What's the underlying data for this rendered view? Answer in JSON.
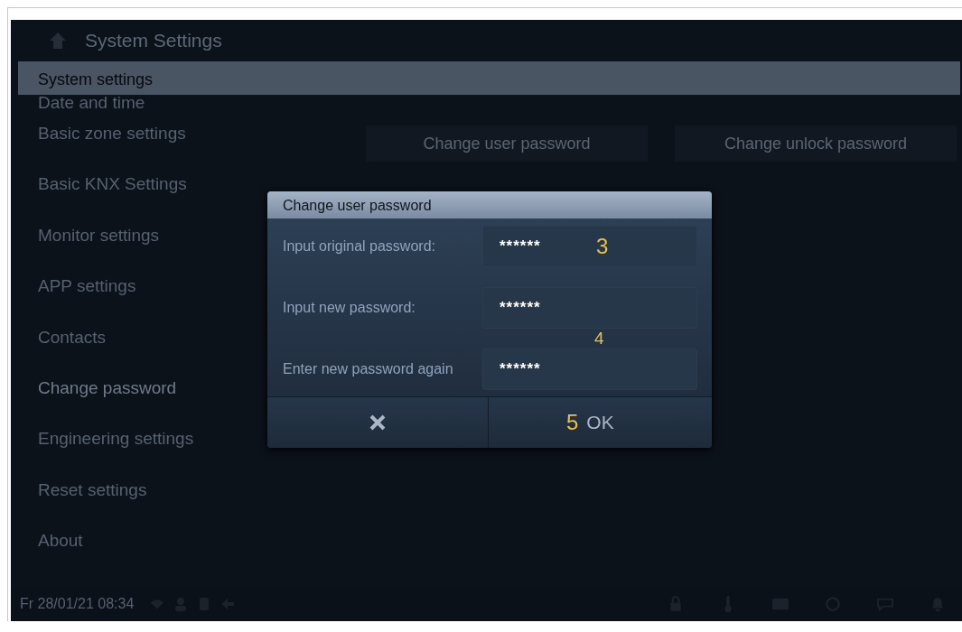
{
  "top_bar": {
    "title": "System Settings"
  },
  "section_header": "System settings",
  "sidebar": {
    "items": [
      {
        "label": "Date and time",
        "selected": false
      },
      {
        "label": "Basic zone settings",
        "selected": false
      },
      {
        "label": "Basic KNX Settings",
        "selected": false
      },
      {
        "label": "Monitor settings",
        "selected": false
      },
      {
        "label": "APP settings",
        "selected": false
      },
      {
        "label": "Contacts",
        "selected": false
      },
      {
        "label": "Change password",
        "selected": true
      },
      {
        "label": "Engineering settings",
        "selected": false
      },
      {
        "label": "Reset settings",
        "selected": false
      },
      {
        "label": "About",
        "selected": false
      }
    ]
  },
  "password_buttons": [
    "Change user password",
    "Change unlock password"
  ],
  "dialog": {
    "title": "Change user password",
    "fields": [
      {
        "label": "Input original password:",
        "value": "******",
        "marker": "3"
      },
      {
        "label": "Input new password:",
        "value": "******"
      },
      {
        "label": "Enter new password again",
        "value": "******"
      }
    ],
    "fields_marker": "4",
    "ok_marker": "5",
    "ok_button": "OK"
  },
  "status_bar": {
    "datetime": "Fr 28/01/21  08:34"
  }
}
